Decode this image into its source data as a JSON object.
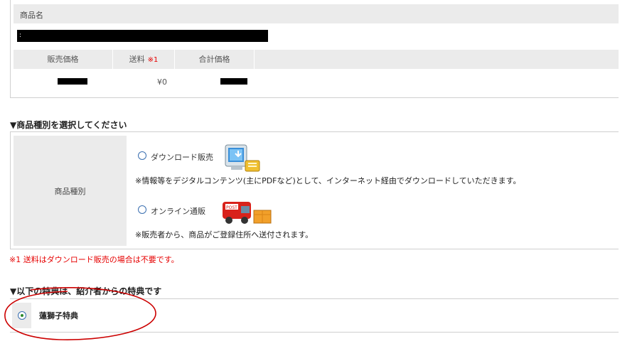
{
  "product": {
    "name_header": "商品名",
    "name_value": ":",
    "headers": {
      "sale_price": "販売価格",
      "shipping": "送料",
      "shipping_mark": "※1",
      "total_price": "合計価格"
    },
    "shipping_value": "¥0"
  },
  "type_section": {
    "title": "▼商品種別を選択してください",
    "label": "商品種別",
    "options": [
      {
        "label": "ダウンロード販売",
        "note": "※情報等をデジタルコンテンツ(主にPDFなど)として、インターネット経由でダウンロードしていただきます。",
        "icon": "computer-download-icon"
      },
      {
        "label": "オンライン通販",
        "note": "※販売者から、商品がご登録住所へ送付されます。",
        "icon": "delivery-truck-icon"
      }
    ],
    "footnote": "※1  送料はダウンロード販売の場合は不要です。"
  },
  "benefit_section": {
    "title": "▼以下の特典は、紹介者からの特典です",
    "item_label": "蓮獅子特典",
    "selected": true
  },
  "colors": {
    "header_bg": "#ebebeb",
    "required_red": "#e60000",
    "annotation_red": "#cc0000"
  }
}
